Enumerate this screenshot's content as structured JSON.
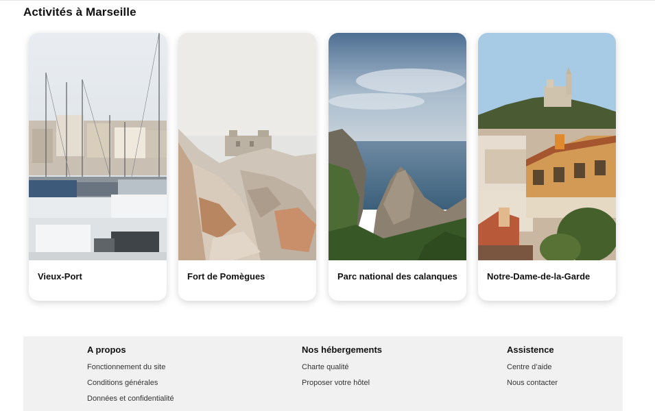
{
  "section": {
    "title": "Activités à Marseille"
  },
  "cards": [
    {
      "title": "Vieux-Port",
      "image_icon": "harbor-photo"
    },
    {
      "title": "Fort de Pomègues",
      "image_icon": "fort-rocks-photo"
    },
    {
      "title": "Parc national des calanques",
      "image_icon": "calanques-coast-photo"
    },
    {
      "title": "Notre-Dame-de-la-Garde",
      "image_icon": "basilica-city-photo"
    }
  ],
  "footer": {
    "columns": [
      {
        "heading": "A propos",
        "links": [
          "Fonctionnement du site",
          "Conditions générales",
          "Données et confidentialité"
        ]
      },
      {
        "heading": "Nos hébergements",
        "links": [
          "Charte qualité",
          "Proposer votre hôtel"
        ]
      },
      {
        "heading": "Assistence",
        "links": [
          "Centre d’aide",
          "Nous contacter"
        ]
      }
    ]
  },
  "colors": {
    "footer_bg": "#f1f1f1",
    "card_shadow": "rgba(0,0,0,0.16)"
  }
}
